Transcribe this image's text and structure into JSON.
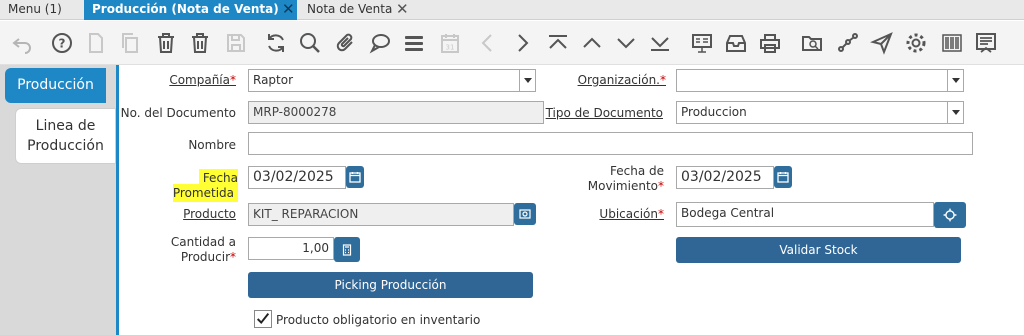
{
  "tabs": [
    {
      "label": "Menu (1)"
    },
    {
      "label": "Producción (Nota de Venta)"
    },
    {
      "label": "Nota de Venta"
    }
  ],
  "toolbar": {
    "icons": [
      "undo-icon",
      "help-icon",
      "new-record-icon",
      "copy-icon",
      "delete-icon",
      "delete-selection-icon",
      "save-icon",
      "refresh-icon",
      "find-icon",
      "attachment-icon",
      "chat-icon",
      "grid-toggle-icon",
      "calendar-icon",
      "previous-icon",
      "next-icon",
      "first-record-icon",
      "up-icon",
      "down-icon",
      "last-record-icon",
      "report-icon",
      "archive-icon",
      "print-icon",
      "zoom-across-icon",
      "workflow-icon",
      "send-icon",
      "settings-icon",
      "barcode-icon",
      "process-icon"
    ]
  },
  "side_tabs": {
    "produccion": "Producción",
    "linea_line1": "Linea de",
    "linea_line2": "Producción"
  },
  "form": {
    "compania_label": "Compañía",
    "compania_value": "Raptor",
    "organizacion_label": "Organización.",
    "organizacion_value": "",
    "no_documento_label": "No. del Documento",
    "no_documento_value": "MRP-8000278",
    "tipo_documento_label": "Tipo de Documento",
    "tipo_documento_value": "Produccion",
    "nombre_label": "Nombre",
    "nombre_value": "",
    "fecha_prometida_label": "Fecha Prometida",
    "fecha_prometida_value": "03/02/2025",
    "fecha_movimiento_label_1": "Fecha de",
    "fecha_movimiento_label_2": "Movimiento",
    "fecha_movimiento_value": "03/02/2025",
    "producto_label": "Producto",
    "producto_value": "KIT_ REPARACION",
    "ubicacion_label": "Ubicación",
    "ubicacion_value": "Bodega Central",
    "cantidad_label_1": "Cantidad a",
    "cantidad_label_2": "Producir",
    "cantidad_value": "1,00",
    "validar_stock_label": "Validar Stock",
    "picking_label": "Picking Producción",
    "obligatorio_label": "Producto obligatorio en inventario",
    "obligatorio_checked": true,
    "required_mark": "*"
  },
  "colors": {
    "accent": "#1e88c7",
    "button": "#2f6696",
    "highlight": "#ffff33",
    "required": "#cc0000"
  }
}
